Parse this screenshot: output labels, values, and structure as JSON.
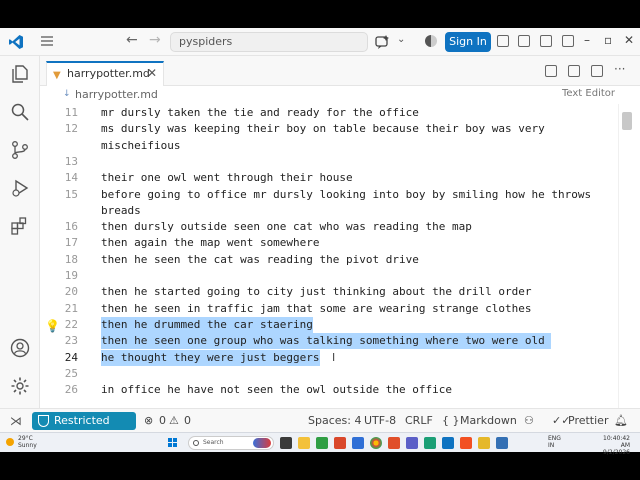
{
  "titlebar": {
    "search_text": "pyspiders",
    "signin_label": "Sign In",
    "window_controls": [
      "–",
      "▫",
      "✕"
    ]
  },
  "activity_bar": {
    "icons": [
      "explorer-icon",
      "search-icon",
      "source-control-icon",
      "run-debug-icon",
      "extensions-icon",
      "account-icon",
      "settings-gear-icon"
    ]
  },
  "tab": {
    "filename": "harrypotter.md",
    "close_glyph": "✕"
  },
  "breadcrumb": {
    "file": "harrypotter.md",
    "editor_mode": "Text Editor"
  },
  "editor": {
    "lines": [
      {
        "num": "11",
        "text": "mr dursly taken the tie and ready for the office"
      },
      {
        "num": "12",
        "text": "ms dursly was keeping their boy on table because their boy was very"
      },
      {
        "num": "",
        "text": "mischeifious"
      },
      {
        "num": "13",
        "text": ""
      },
      {
        "num": "14",
        "text": "their one owl went through their house"
      },
      {
        "num": "15",
        "text": "before going to office mr dursly looking into boy by smiling how he throws"
      },
      {
        "num": "",
        "text": "breads"
      },
      {
        "num": "16",
        "text": "then dursly outside seen one cat who was reading the map"
      },
      {
        "num": "17",
        "text": "then again the map went somewhere"
      },
      {
        "num": "18",
        "text": "then he seen the cat was reading the pivot drive"
      },
      {
        "num": "19",
        "text": ""
      },
      {
        "num": "20",
        "text": "then he started going to city just thinking about the drill order"
      },
      {
        "num": "21",
        "text": "then he seen in traffic jam that some are wearing strange clothes"
      },
      {
        "num": "22",
        "text": "then he drummed the car staering",
        "selected": true
      },
      {
        "num": "23",
        "text": "then he seen one group who was talking something where two were old ",
        "selected": true
      },
      {
        "num": "24",
        "text": "he thought they were just beggers",
        "selected": true,
        "active": true
      },
      {
        "num": "25",
        "text": ""
      },
      {
        "num": "26",
        "text": "in office he have not seen the owl outside the office"
      }
    ]
  },
  "statusbar": {
    "restricted_label": "Restricted Mode",
    "errors": "0",
    "warnings": "0",
    "spaces": "Spaces: 4",
    "encoding": "UTF-8",
    "eol": "CRLF",
    "language": "Markdown",
    "prettier": "Prettier"
  },
  "taskbar": {
    "temperature": "29°C",
    "weather": "Sunny",
    "search_placeholder": "Search",
    "language_top": "ENG",
    "language_bottom": "IN",
    "time": "10:40:42 AM",
    "date": "9/2/2026"
  },
  "colors": {
    "accent": "#0f73c1",
    "restricted": "#138bb3",
    "selection": "#add6ff"
  }
}
